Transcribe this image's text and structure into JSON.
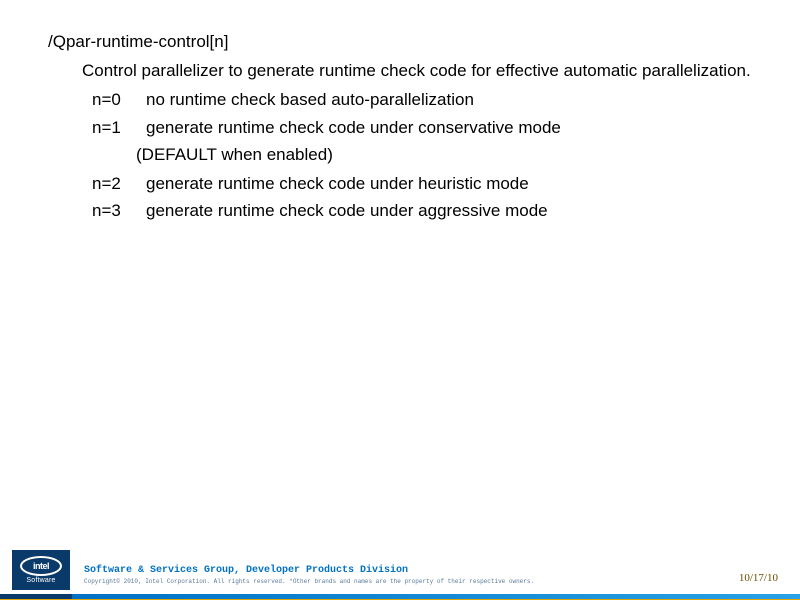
{
  "content": {
    "title": "/Qpar-runtime-control[n]",
    "description": "Control parallelizer to generate runtime check code for effective automatic parallelization.",
    "options": [
      {
        "key": "n=0",
        "value": "no runtime check based auto-parallelization",
        "note": ""
      },
      {
        "key": "n=1",
        "value": "generate runtime check code under conservative mode",
        "note": "(DEFAULT when enabled)"
      },
      {
        "key": "n=2",
        "value": "generate runtime check code under heuristic mode",
        "note": ""
      },
      {
        "key": "n=3",
        "value": "generate runtime check code under aggressive mode",
        "note": ""
      }
    ]
  },
  "footer": {
    "logo_text": "intel",
    "logo_subtitle": "Software",
    "division": "Software & Services Group, Developer Products Division",
    "copyright": "Copyright© 2010, Intel Corporation. All rights reserved. *Other brands and names are the property of their respective owners.",
    "date": "10/17/10"
  }
}
